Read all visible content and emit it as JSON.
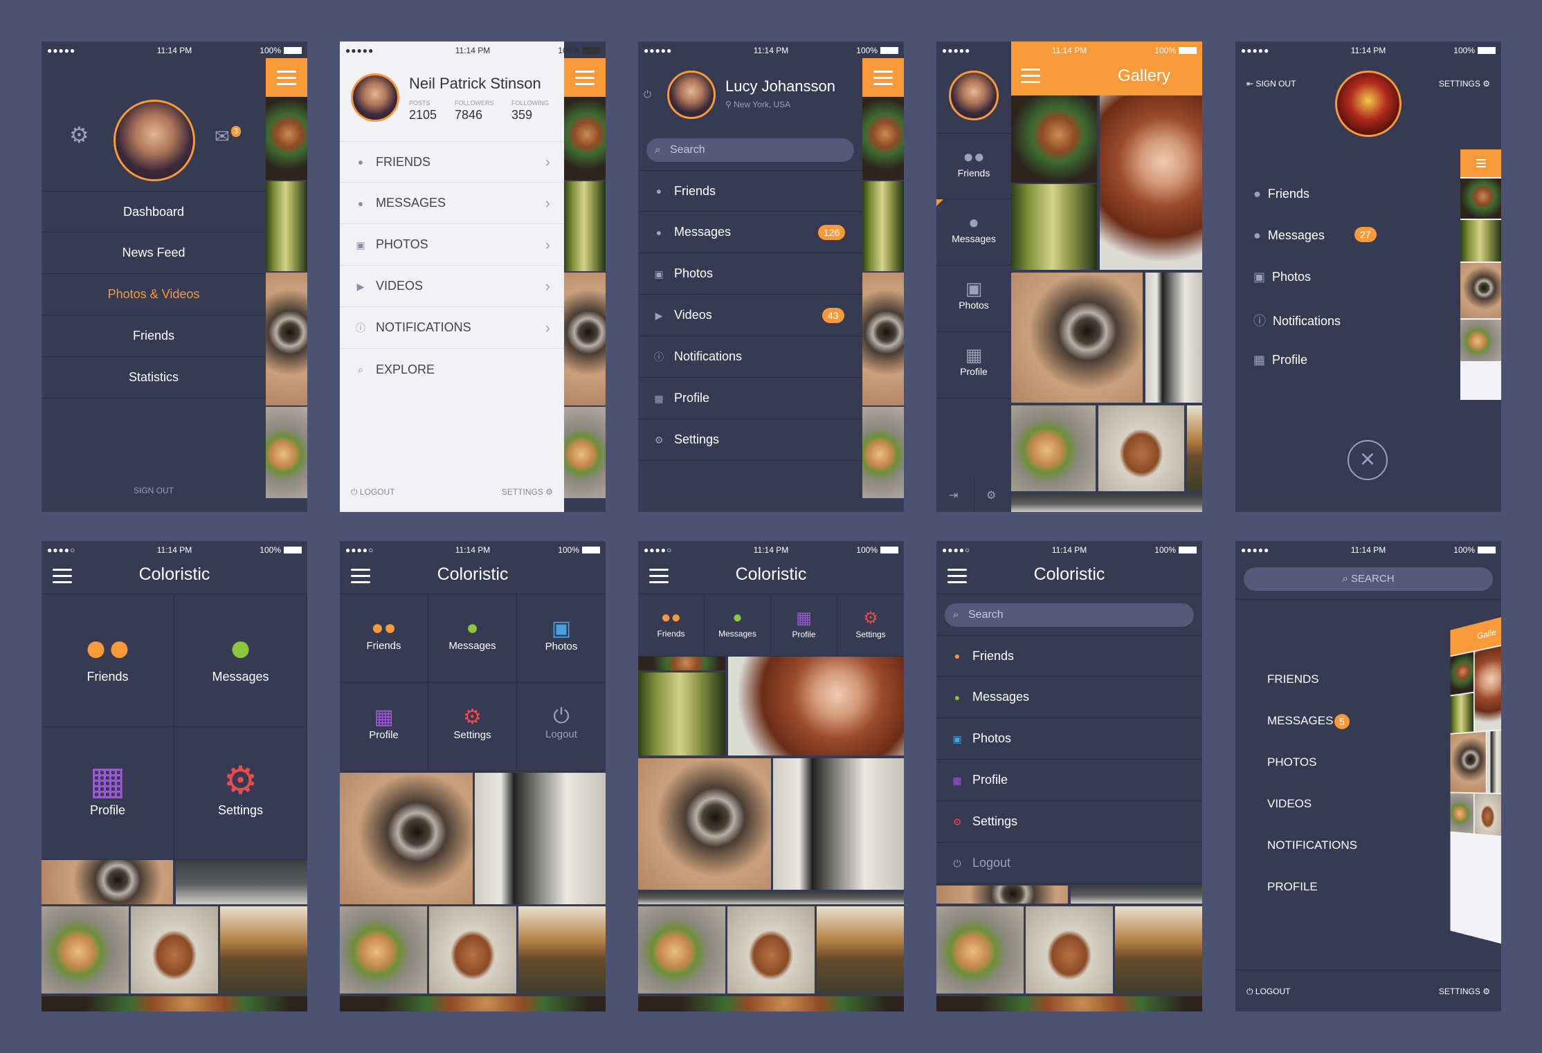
{
  "status": {
    "time": "11:14 PM",
    "battery": "100%",
    "signal": "●●●●●",
    "signal_r2": "●●●●○"
  },
  "s1": {
    "menu": [
      "Dashboard",
      "News Feed",
      "Photos & Videos",
      "Friends",
      "Statistics"
    ],
    "badge": "3",
    "signout": "SIGN OUT"
  },
  "s2": {
    "name": "Neil Patrick Stinson",
    "stats": [
      {
        "label": "POSTS",
        "value": "2105"
      },
      {
        "label": "FOLLOWERS",
        "value": "7846"
      },
      {
        "label": "FOLLOWING",
        "value": "359"
      }
    ],
    "menu": [
      "FRIENDS",
      "MESSAGES",
      "PHOTOS",
      "VIDEOS",
      "NOTIFICATIONS",
      "EXPLORE"
    ],
    "logout": "LOGOUT",
    "settings": "SETTINGS"
  },
  "s3": {
    "name": "Lucy Johansson",
    "location": "New York, USA",
    "search_placeholder": "Search",
    "menu": [
      "Friends",
      "Messages",
      "Photos",
      "Videos",
      "Notifications",
      "Profile",
      "Settings"
    ],
    "messages_badge": "126",
    "videos_badge": "43"
  },
  "s4": {
    "gallery": "Gallery",
    "tabs": [
      "Friends",
      "Messages",
      "Photos",
      "Profile"
    ]
  },
  "s5": {
    "signout": "SIGN OUT",
    "settings": "SETTINGS",
    "menu": [
      "Friends",
      "Messages",
      "Photos",
      "Notifications",
      "Profile"
    ],
    "messages_badge": "27"
  },
  "s6": {
    "title": "Coloristic",
    "tiles": [
      "Friends",
      "Messages",
      "Profile",
      "Settings"
    ]
  },
  "s7": {
    "title": "Coloristic",
    "tiles": [
      "Friends",
      "Messages",
      "Photos",
      "Profile",
      "Settings",
      "Logout"
    ]
  },
  "s8": {
    "title": "Coloristic",
    "tabs": [
      "Friends",
      "Messages",
      "Profile",
      "Settings"
    ]
  },
  "s9": {
    "title": "Coloristic",
    "search_placeholder": "Search",
    "menu": [
      "Friends",
      "Messages",
      "Photos",
      "Profile",
      "Settings",
      "Logout"
    ]
  },
  "s10": {
    "search_placeholder": "SEARCH",
    "menu": [
      "FRIENDS",
      "MESSAGES",
      "PHOTOS",
      "VIDEOS",
      "NOTIFICATIONS",
      "PROFILE"
    ],
    "messages_badge": "5",
    "logout": "LOGOUT",
    "settings": "SETTINGS",
    "peek_title": "Galle"
  },
  "colors": {
    "background": "#4d5172",
    "panel": "#363a53",
    "accent": "#f8993a",
    "light_panel": "#f2f2f6",
    "green": "#8cc63f",
    "blue": "#4a9fe0",
    "purple": "#9b59d0",
    "red": "#e84c4c"
  }
}
